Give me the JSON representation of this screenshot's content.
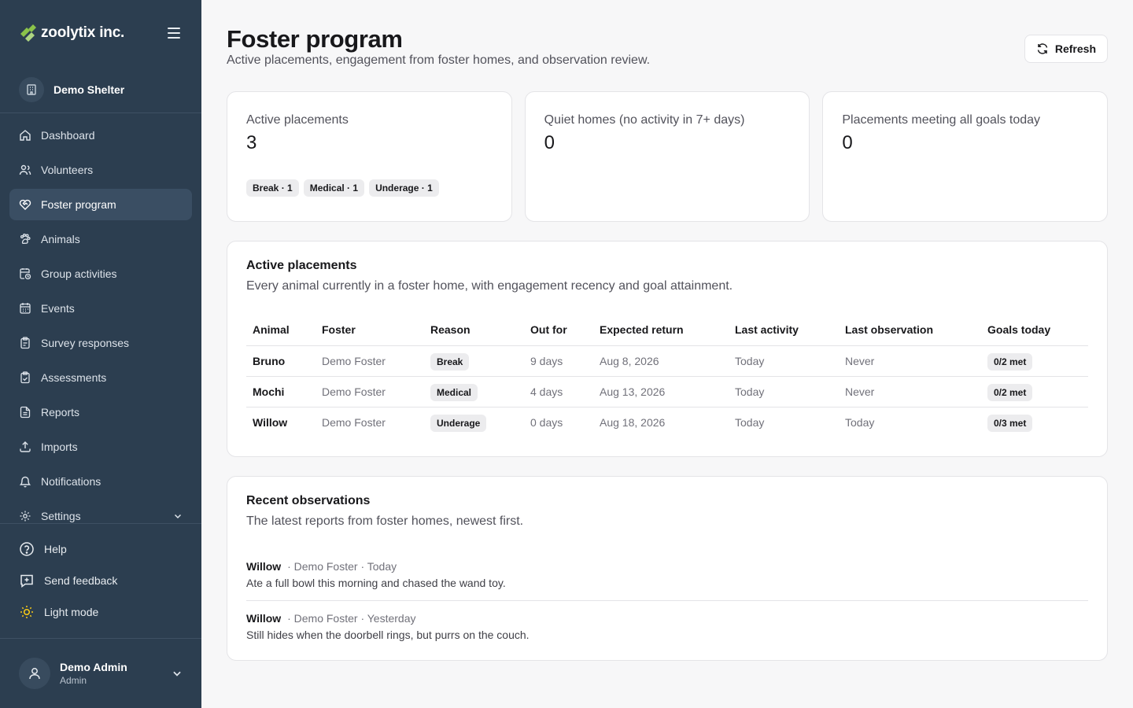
{
  "brand": {
    "name": "zoolytix inc.",
    "accent": "#8bc34a"
  },
  "org": {
    "name": "Demo Shelter"
  },
  "nav": [
    {
      "label": "Dashboard",
      "icon": "home-icon",
      "active": false
    },
    {
      "label": "Volunteers",
      "icon": "users-icon",
      "active": false
    },
    {
      "label": "Foster program",
      "icon": "heart-handshake-icon",
      "active": true
    },
    {
      "label": "Animals",
      "icon": "paw-icon",
      "active": false
    },
    {
      "label": "Group activities",
      "icon": "calendar-clock-icon",
      "active": false
    },
    {
      "label": "Events",
      "icon": "calendar-icon",
      "active": false
    },
    {
      "label": "Survey responses",
      "icon": "clipboard-icon",
      "active": false
    },
    {
      "label": "Assessments",
      "icon": "clipboard-check-icon",
      "active": false
    },
    {
      "label": "Reports",
      "icon": "file-text-icon",
      "active": false
    },
    {
      "label": "Imports",
      "icon": "upload-icon",
      "active": false
    },
    {
      "label": "Notifications",
      "icon": "bell-icon",
      "active": false
    },
    {
      "label": "Settings",
      "icon": "gear-icon",
      "active": false
    }
  ],
  "bottom": {
    "help": "Help",
    "feedback": "Send feedback",
    "theme": "Light mode"
  },
  "user": {
    "name": "Demo Admin",
    "role": "Admin"
  },
  "header": {
    "title": "Foster program",
    "subtitle": "Active placements, engagement from foster homes, and observation review.",
    "refresh_label": "Refresh"
  },
  "stats": [
    {
      "label": "Active placements",
      "value": "3",
      "chips": [
        "Break · 1",
        "Medical · 1",
        "Underage · 1"
      ]
    },
    {
      "label": "Quiet homes (no activity in 7+ days)",
      "value": "0"
    },
    {
      "label": "Placements meeting all goals today",
      "value": "0"
    }
  ],
  "placements": {
    "title": "Active placements",
    "subtitle": "Every animal currently in a foster home, with engagement recency and goal attainment.",
    "columns": [
      "Animal",
      "Foster",
      "Reason",
      "Out for",
      "Expected return",
      "Last activity",
      "Last observation",
      "Goals today"
    ],
    "rows": [
      {
        "animal": "Bruno",
        "foster": "Demo Foster",
        "reason": "Break",
        "out_for": "9 days",
        "expected_return": "Aug 8, 2026",
        "last_activity": "Today",
        "last_observation": "Never",
        "goals": "0/2 met"
      },
      {
        "animal": "Mochi",
        "foster": "Demo Foster",
        "reason": "Medical",
        "out_for": "4 days",
        "expected_return": "Aug 13, 2026",
        "last_activity": "Today",
        "last_observation": "Never",
        "goals": "0/2 met"
      },
      {
        "animal": "Willow",
        "foster": "Demo Foster",
        "reason": "Underage",
        "out_for": "0 days",
        "expected_return": "Aug 18, 2026",
        "last_activity": "Today",
        "last_observation": "Today",
        "goals": "0/3 met"
      }
    ]
  },
  "observations": {
    "title": "Recent observations",
    "subtitle": "The latest reports from foster homes, newest first.",
    "items": [
      {
        "animal": "Willow",
        "meta": "· Demo Foster · Today",
        "text": "Ate a full bowl this morning and chased the wand toy."
      },
      {
        "animal": "Willow",
        "meta": "· Demo Foster · Yesterday",
        "text": "Still hides when the doorbell rings, but purrs on the couch."
      }
    ]
  }
}
